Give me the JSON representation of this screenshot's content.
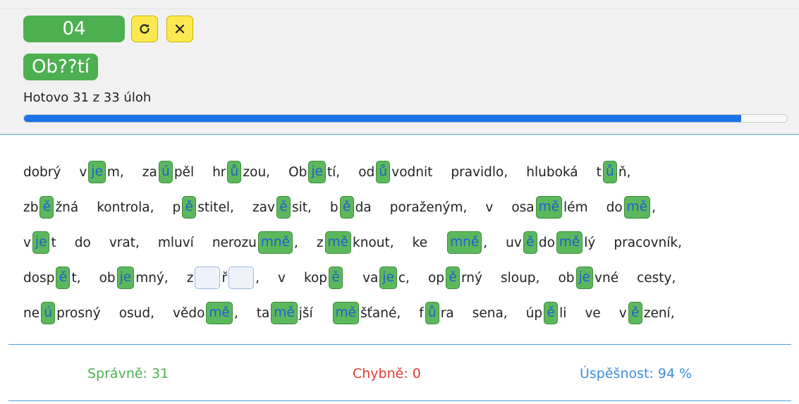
{
  "header": {
    "task_number": "04",
    "refresh_icon": "refresh-icon",
    "close_icon": "close-icon",
    "word": "Ob??tí",
    "progress_text": "Hotovo 31 z 33 úloh",
    "progress_fraction": 0.94,
    "colors": {
      "accent_green": "#4caf50",
      "button_yellow": "#fce94f",
      "progress_blue": "#1a73e8"
    }
  },
  "exercise": {
    "lines": [
      [
        [
          {
            "t": "dobrý"
          }
        ],
        [
          {
            "t": "v"
          },
          {
            "g": "je"
          },
          {
            "t": "m,"
          }
        ],
        [
          {
            "t": "za"
          },
          {
            "g": "ú"
          },
          {
            "t": "pěl"
          }
        ],
        [
          {
            "t": "hr"
          },
          {
            "g": "ů"
          },
          {
            "t": "zou,"
          }
        ],
        [
          {
            "t": "Ob"
          },
          {
            "g": "je"
          },
          {
            "t": "tí,"
          }
        ],
        [
          {
            "t": "od"
          },
          {
            "g": "ů"
          },
          {
            "t": "vodnit"
          }
        ],
        [
          {
            "t": "pravidlo,"
          }
        ],
        [
          {
            "t": "hluboká"
          }
        ],
        [
          {
            "t": "t"
          },
          {
            "g": "ů"
          },
          {
            "t": "ň,"
          }
        ]
      ],
      [
        [
          {
            "t": "zb"
          },
          {
            "g": "ě"
          },
          {
            "t": "žná"
          }
        ],
        [
          {
            "t": "kontrola,"
          }
        ],
        [
          {
            "t": "p"
          },
          {
            "g": "ě"
          },
          {
            "t": "stitel,"
          }
        ],
        [
          {
            "t": "zav"
          },
          {
            "g": "ě"
          },
          {
            "t": "sit,"
          }
        ],
        [
          {
            "t": "b"
          },
          {
            "g": "ě"
          },
          {
            "t": "da"
          }
        ],
        [
          {
            "t": "poraženým,"
          }
        ],
        [
          {
            "t": "v"
          }
        ],
        [
          {
            "t": "osa"
          },
          {
            "g": "mě"
          },
          {
            "t": "lém"
          }
        ],
        [
          {
            "t": "do"
          },
          {
            "g": "mě"
          },
          {
            "t": ","
          }
        ]
      ],
      [
        [
          {
            "t": "v"
          },
          {
            "g": "je"
          },
          {
            "t": "t"
          }
        ],
        [
          {
            "t": "do"
          }
        ],
        [
          {
            "t": "vrat,"
          }
        ],
        [
          {
            "t": "mluví"
          }
        ],
        [
          {
            "t": "nerozu"
          },
          {
            "g": "mně"
          },
          {
            "t": ","
          }
        ],
        [
          {
            "t": "z"
          },
          {
            "g": "mě"
          },
          {
            "t": "knout,"
          }
        ],
        [
          {
            "t": "ke"
          }
        ],
        [
          {
            "g": "mně"
          },
          {
            "t": ","
          }
        ],
        [
          {
            "t": "uv"
          },
          {
            "g": "ě"
          },
          {
            "t": "do"
          },
          {
            "g": "mě"
          },
          {
            "t": "lý"
          }
        ],
        [
          {
            "t": "pracovník,"
          }
        ]
      ],
      [
        [
          {
            "t": "dosp"
          },
          {
            "g": "ě"
          },
          {
            "t": "t,"
          }
        ],
        [
          {
            "t": "ob"
          },
          {
            "g": "je"
          },
          {
            "t": "mný,"
          }
        ],
        [
          {
            "t": "z"
          },
          {
            "e": ""
          },
          {
            "t": "ř"
          },
          {
            "e": ""
          },
          {
            "t": ","
          }
        ],
        [
          {
            "t": "v"
          }
        ],
        [
          {
            "t": "kop"
          },
          {
            "g": "ě"
          },
          {
            "t": ""
          }
        ],
        [
          {
            "t": "va"
          },
          {
            "g": "je"
          },
          {
            "t": "c,"
          }
        ],
        [
          {
            "t": "op"
          },
          {
            "g": "ě"
          },
          {
            "t": "rný"
          }
        ],
        [
          {
            "t": "sloup,"
          }
        ],
        [
          {
            "t": "ob"
          },
          {
            "g": "je"
          },
          {
            "t": "vné"
          }
        ],
        [
          {
            "t": "cesty,"
          }
        ]
      ],
      [
        [
          {
            "t": "ne"
          },
          {
            "g": "ú"
          },
          {
            "t": "prosný"
          }
        ],
        [
          {
            "t": "osud,"
          }
        ],
        [
          {
            "t": "vědo"
          },
          {
            "g": "mě"
          },
          {
            "t": ","
          }
        ],
        [
          {
            "t": "ta"
          },
          {
            "g": "mě"
          },
          {
            "t": "jší"
          }
        ],
        [
          {
            "g": "mě"
          },
          {
            "t": "šťané,"
          }
        ],
        [
          {
            "t": "f"
          },
          {
            "g": "ů"
          },
          {
            "t": "ra"
          }
        ],
        [
          {
            "t": "sena,"
          }
        ],
        [
          {
            "t": "úp"
          },
          {
            "g": "ě"
          },
          {
            "t": "li"
          }
        ],
        [
          {
            "t": "ve"
          }
        ],
        [
          {
            "t": "v"
          },
          {
            "g": "ě"
          },
          {
            "t": "zení,"
          }
        ]
      ]
    ]
  },
  "stats": {
    "correct": "Správně: 31",
    "wrong": "Chybně: 0",
    "rate": "Úspěšnost: 94 %"
  }
}
